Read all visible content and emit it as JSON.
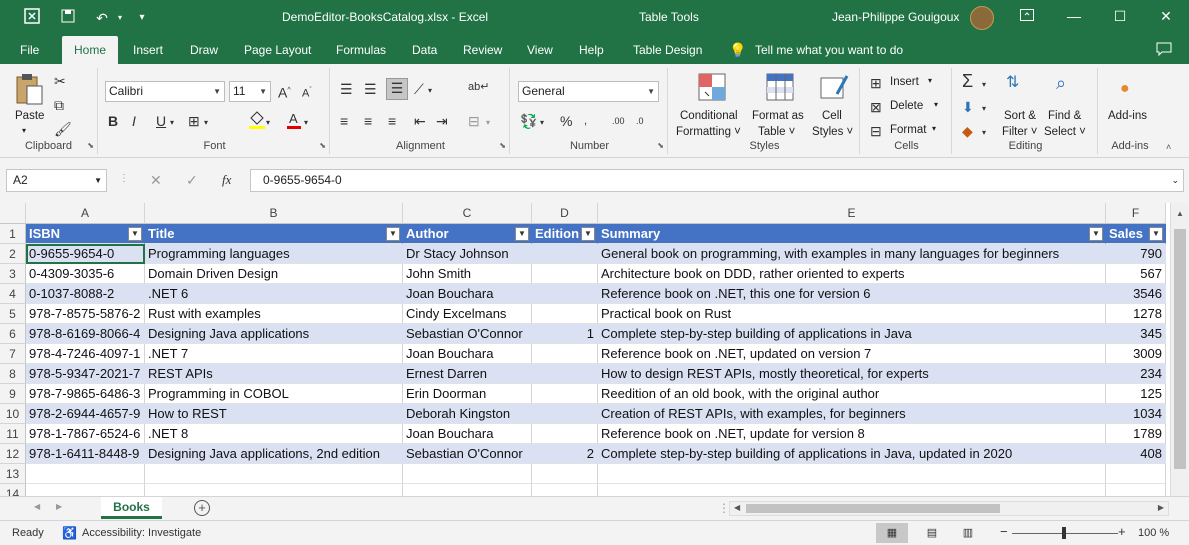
{
  "titlebar": {
    "file_name": "DemoEditor-BooksCatalog.xlsx  -  Excel",
    "contextual": "Table Tools",
    "user": "Jean-Philippe Gouigoux"
  },
  "tabs": [
    "File",
    "Home",
    "Insert",
    "Draw",
    "Page Layout",
    "Formulas",
    "Data",
    "Review",
    "View",
    "Help",
    "Table Design"
  ],
  "tell_me": "Tell me what you want to do",
  "ribbon": {
    "clipboard": {
      "label": "Clipboard",
      "paste": "Paste"
    },
    "font": {
      "label": "Font",
      "name": "Calibri",
      "size": "11"
    },
    "alignment": {
      "label": "Alignment"
    },
    "number": {
      "label": "Number",
      "format": "General"
    },
    "styles": {
      "label": "Styles",
      "cond1": "Conditional",
      "cond2": "Formatting ˅",
      "fmt1": "Format as",
      "fmt2": "Table ˅",
      "cell1": "Cell",
      "cell2": "Styles ˅"
    },
    "cells": {
      "label": "Cells",
      "insert": "Insert",
      "delete": "Delete",
      "format": "Format"
    },
    "editing": {
      "label": "Editing",
      "sort1": "Sort &",
      "sort2": "Filter ˅",
      "find1": "Find &",
      "find2": "Select ˅"
    },
    "addins": {
      "label": "Add-ins",
      "button": "Add-ins"
    }
  },
  "formula_bar": {
    "name_box": "A2",
    "value": "0-9655-9654-0"
  },
  "columns": [
    "A",
    "B",
    "C",
    "D",
    "E",
    "F"
  ],
  "headers": [
    "ISBN",
    "Title",
    "Author",
    "Edition",
    "Summary",
    "Sales"
  ],
  "rows": [
    [
      "0-9655-9654-0",
      "Programming languages",
      "Dr Stacy Johnson",
      "",
      "General book on programming, with examples in many languages for beginners",
      "790"
    ],
    [
      "0-4309-3035-6",
      "Domain Driven Design",
      "John Smith",
      "",
      "Architecture book on DDD, rather oriented to experts",
      "567"
    ],
    [
      "0-1037-8088-2",
      ".NET 6",
      "Joan Bouchara",
      "",
      "Reference book on .NET, this one for version 6",
      "3546"
    ],
    [
      "978-7-8575-5876-2",
      "Rust with examples",
      "Cindy Excelmans",
      "",
      "Practical book on Rust",
      "1278"
    ],
    [
      "978-8-6169-8066-4",
      "Designing Java applications",
      "Sebastian O'Connor",
      "1",
      "Complete step-by-step building of applications in Java",
      "345"
    ],
    [
      "978-4-7246-4097-1",
      ".NET 7",
      "Joan Bouchara",
      "",
      "Reference book on .NET, updated on version 7",
      "3009"
    ],
    [
      "978-5-9347-2021-7",
      "REST APIs",
      "Ernest Darren",
      "",
      "How to design REST APIs, mostly theoretical, for experts",
      "234"
    ],
    [
      "978-7-9865-6486-3",
      "Programming in COBOL",
      "Erin Doorman",
      "",
      "Reedition of an old book, with the original author",
      "125"
    ],
    [
      "978-2-6944-4657-9",
      "How to REST",
      "Deborah Kingston",
      "",
      "Creation of REST APIs, with examples, for beginners",
      "1034"
    ],
    [
      "978-1-7867-6524-6",
      ".NET 8",
      "Joan Bouchara",
      "",
      "Reference book on .NET, update for version 8",
      "1789"
    ],
    [
      "978-1-6411-8448-9",
      "Designing Java applications, 2nd edition",
      "Sebastian O'Connor",
      "2",
      "Complete step-by-step building of applications in Java, updated in 2020",
      "408"
    ]
  ],
  "row_numbers": [
    "1",
    "2",
    "3",
    "4",
    "5",
    "6",
    "7",
    "8",
    "9",
    "10",
    "11",
    "12",
    "13",
    "14"
  ],
  "sheet_tab": "Books",
  "status": {
    "ready": "Ready",
    "accessibility": "Accessibility: Investigate",
    "zoom": "100 %"
  },
  "colors": {
    "excel_green": "#217346",
    "table_header": "#4472c4",
    "table_band": "#d9e1f2"
  }
}
